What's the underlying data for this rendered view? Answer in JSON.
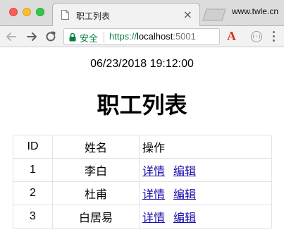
{
  "browser": {
    "tab_title": "职工列表",
    "tab_close": "×",
    "user_domain": "www.twle.cn",
    "secure_label": "安全",
    "url_scheme": "https://",
    "url_host": "localhost",
    "url_port": ":5001",
    "extension_label": "A",
    "extension_circle_label": "(·)"
  },
  "page": {
    "timestamp": "06/23/2018 19:12:00",
    "title": "职工列表",
    "table": {
      "headers": {
        "id": "ID",
        "name": "姓名",
        "actions": "操作"
      },
      "rows": [
        {
          "id": "1",
          "name": "李白",
          "detail": "详情",
          "edit": "编辑"
        },
        {
          "id": "2",
          "name": "杜甫",
          "detail": "详情",
          "edit": "编辑"
        },
        {
          "id": "3",
          "name": "白居易",
          "detail": "详情",
          "edit": "编辑"
        }
      ]
    }
  }
}
